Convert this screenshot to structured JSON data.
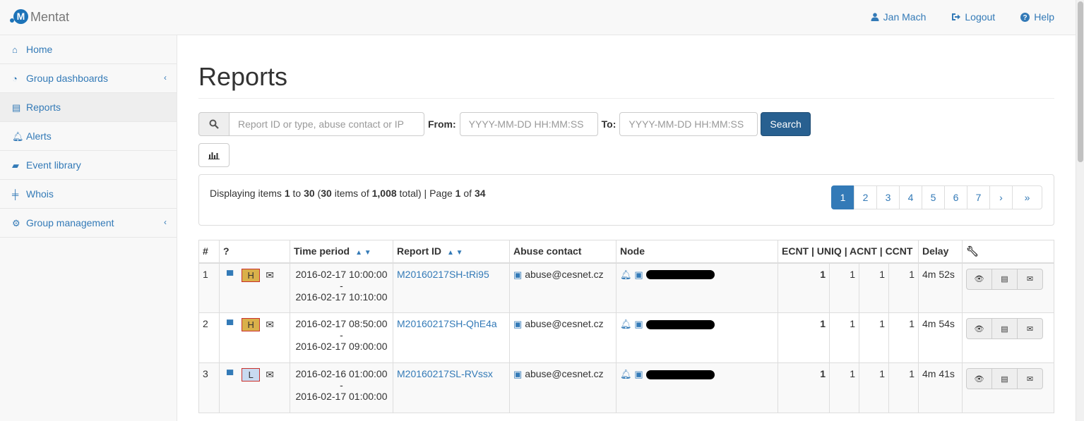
{
  "nav": {
    "brand": "Mentat",
    "user": "Jan Mach",
    "logout": "Logout",
    "help": "Help"
  },
  "sidebar": {
    "items": [
      {
        "label": "Home",
        "icon": "home-icon"
      },
      {
        "label": "Group dashboards",
        "icon": "dashboard-icon"
      },
      {
        "label": "Reports",
        "icon": "newspaper-icon"
      },
      {
        "label": "Alerts",
        "icon": "bell-icon"
      },
      {
        "label": "Event library",
        "icon": "book-icon"
      },
      {
        "label": "Whois",
        "icon": "signpost-icon"
      },
      {
        "label": "Group management",
        "icon": "cogs-icon"
      }
    ]
  },
  "page": {
    "title": "Reports"
  },
  "search": {
    "placeholder": "Report ID or type, abuse contact or IP",
    "from_label": "From:",
    "from_placeholder": "YYYY-MM-DD HH:MM:SS",
    "to_label": "To:",
    "to_placeholder": "YYYY-MM-DD HH:MM:SS",
    "button": "Search"
  },
  "summary": {
    "prefix": "Displaying items ",
    "from": "1",
    "to_word": " to ",
    "to": "30",
    "paren_open": " (",
    "count": "30",
    "items_of": " items of ",
    "total": "1,008",
    "total_close": " total) | Page ",
    "page": "1",
    "of": " of ",
    "pages": "34"
  },
  "pagination": [
    "1",
    "2",
    "3",
    "4",
    "5",
    "6",
    "7",
    "›",
    "»"
  ],
  "table": {
    "headers": [
      "#",
      "?",
      "Time period",
      "Report ID",
      "Abuse contact",
      "Node",
      "ECNT | UNIQ | ACNT | CCNT",
      "Delay"
    ],
    "rows": [
      {
        "n": "1",
        "sev": "H",
        "from": "2016-02-17 10:00:00",
        "sep": "-",
        "to": "2016-02-17 10:10:00",
        "id": "M20160217SH-tRi95",
        "abuse": "abuse@cesnet.cz",
        "ecnt": "1",
        "uniq": "1",
        "acnt": "1",
        "ccnt": "1",
        "delay": "4m 52s"
      },
      {
        "n": "2",
        "sev": "H",
        "from": "2016-02-17 08:50:00",
        "sep": "-",
        "to": "2016-02-17 09:00:00",
        "id": "M20160217SH-QhE4a",
        "abuse": "abuse@cesnet.cz",
        "ecnt": "1",
        "uniq": "1",
        "acnt": "1",
        "ccnt": "1",
        "delay": "4m 54s"
      },
      {
        "n": "3",
        "sev": "L",
        "from": "2016-02-16 01:00:00",
        "sep": "-",
        "to": "2016-02-17 01:00:00",
        "id": "M20160217SL-RVssx",
        "abuse": "abuse@cesnet.cz",
        "ecnt": "1",
        "uniq": "1",
        "acnt": "1",
        "ccnt": "1",
        "delay": "4m 41s"
      }
    ]
  }
}
